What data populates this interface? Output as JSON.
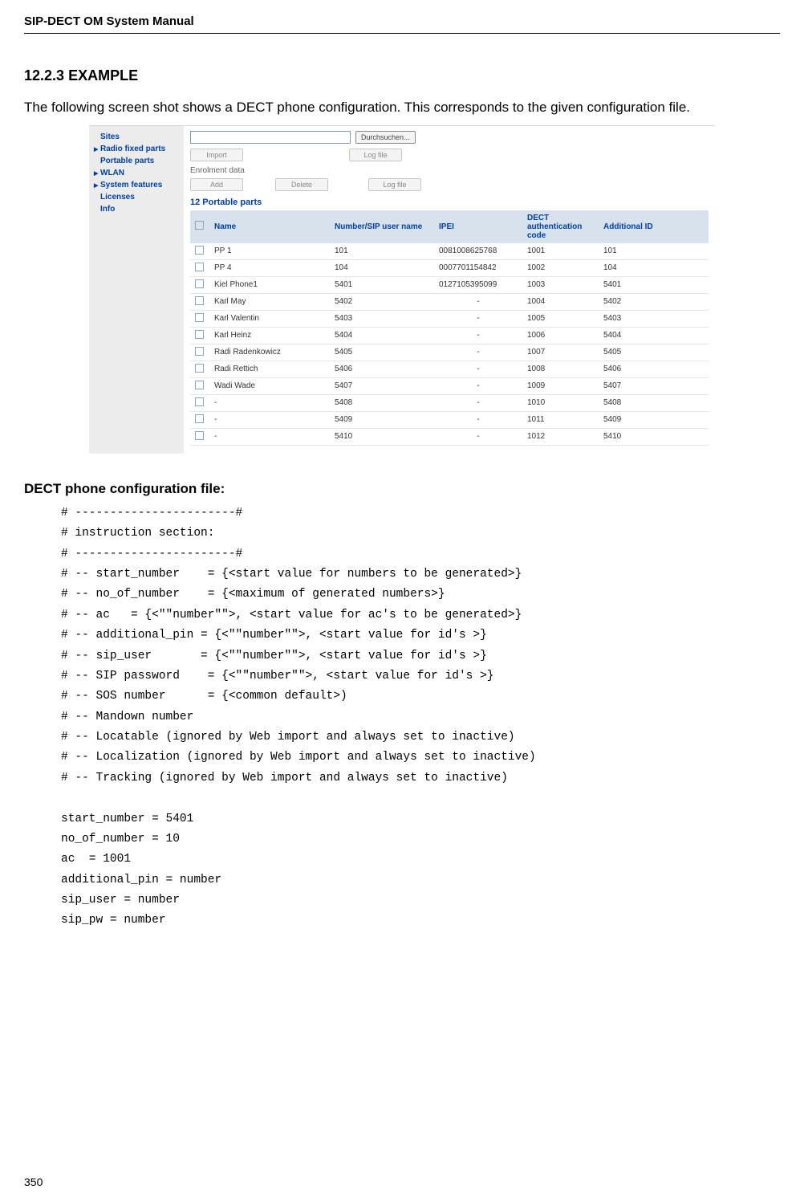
{
  "header": {
    "running_head": "SIP-DECT OM System Manual"
  },
  "section": {
    "number": "12.2.3",
    "title": "EXAMPLE",
    "intro": "The following screen shot shows a DECT phone configuration. This corresponds to the given configuration file."
  },
  "screenshot": {
    "nav": [
      {
        "label": "Sites",
        "caret": false
      },
      {
        "label": "Radio fixed parts",
        "caret": true
      },
      {
        "label": "Portable parts",
        "caret": false
      },
      {
        "label": "WLAN",
        "caret": true
      },
      {
        "label": "System features",
        "caret": true
      },
      {
        "label": "Licenses",
        "caret": false
      },
      {
        "label": "Info",
        "caret": false
      }
    ],
    "buttons": {
      "browse": "Durchsuchen...",
      "import": "Import",
      "logfile": "Log file",
      "add": "Add",
      "delete": "Delete"
    },
    "enrolment_label": "Enrolment data",
    "table_heading": "12 Portable parts",
    "columns": {
      "name": "Name",
      "number": "Number/SIP user name",
      "ipei": "IPEI",
      "auth": "DECT authentication code",
      "addl": "Additional ID"
    },
    "rows": [
      {
        "name": "PP 1",
        "number": "101",
        "ipei": "0081008625768",
        "auth": "1001",
        "addl": "101"
      },
      {
        "name": "PP 4",
        "number": "104",
        "ipei": "0007701154842",
        "auth": "1002",
        "addl": "104"
      },
      {
        "name": "Kiel Phone1",
        "number": "5401",
        "ipei": "0127105395099",
        "auth": "1003",
        "addl": "5401"
      },
      {
        "name": "Karl May",
        "number": "5402",
        "ipei": "-",
        "auth": "1004",
        "addl": "5402"
      },
      {
        "name": "Karl Valentin",
        "number": "5403",
        "ipei": "-",
        "auth": "1005",
        "addl": "5403"
      },
      {
        "name": "Karl Heinz",
        "number": "5404",
        "ipei": "-",
        "auth": "1006",
        "addl": "5404"
      },
      {
        "name": "Radi Radenkowicz",
        "number": "5405",
        "ipei": "-",
        "auth": "1007",
        "addl": "5405"
      },
      {
        "name": "Radi Rettich",
        "number": "5406",
        "ipei": "-",
        "auth": "1008",
        "addl": "5406"
      },
      {
        "name": "Wadi Wade",
        "number": "5407",
        "ipei": "-",
        "auth": "1009",
        "addl": "5407"
      },
      {
        "name": "-",
        "number": "5408",
        "ipei": "-",
        "auth": "1010",
        "addl": "5408"
      },
      {
        "name": "-",
        "number": "5409",
        "ipei": "-",
        "auth": "1011",
        "addl": "5409"
      },
      {
        "name": "-",
        "number": "5410",
        "ipei": "-",
        "auth": "1012",
        "addl": "5410"
      }
    ]
  },
  "config": {
    "title": "DECT phone configuration file:",
    "lines": [
      "# -----------------------#",
      "# instruction section:",
      "# -----------------------#",
      "# -- start_number    = {<start value for numbers to be generated>}",
      "# -- no_of_number    = {<maximum of generated numbers>}",
      "# -- ac   = {<\"\"number\"\">, <start value for ac's to be generated>}",
      "# -- additional_pin = {<\"\"number\"\">, <start value for id's >}",
      "# -- sip_user       = {<\"\"number\"\">, <start value for id's >}",
      "# -- SIP password    = {<\"\"number\"\">, <start value for id's >}",
      "# -- SOS number      = {<common default>)",
      "# -- Mandown number",
      "# -- Locatable (ignored by Web import and always set to inactive)",
      "# -- Localization (ignored by Web import and always set to inactive)",
      "# -- Tracking (ignored by Web import and always set to inactive)",
      "",
      "start_number = 5401",
      "no_of_number = 10",
      "ac  = 1001",
      "additional_pin = number",
      "sip_user = number",
      "sip_pw = number"
    ]
  },
  "page_number": "350"
}
